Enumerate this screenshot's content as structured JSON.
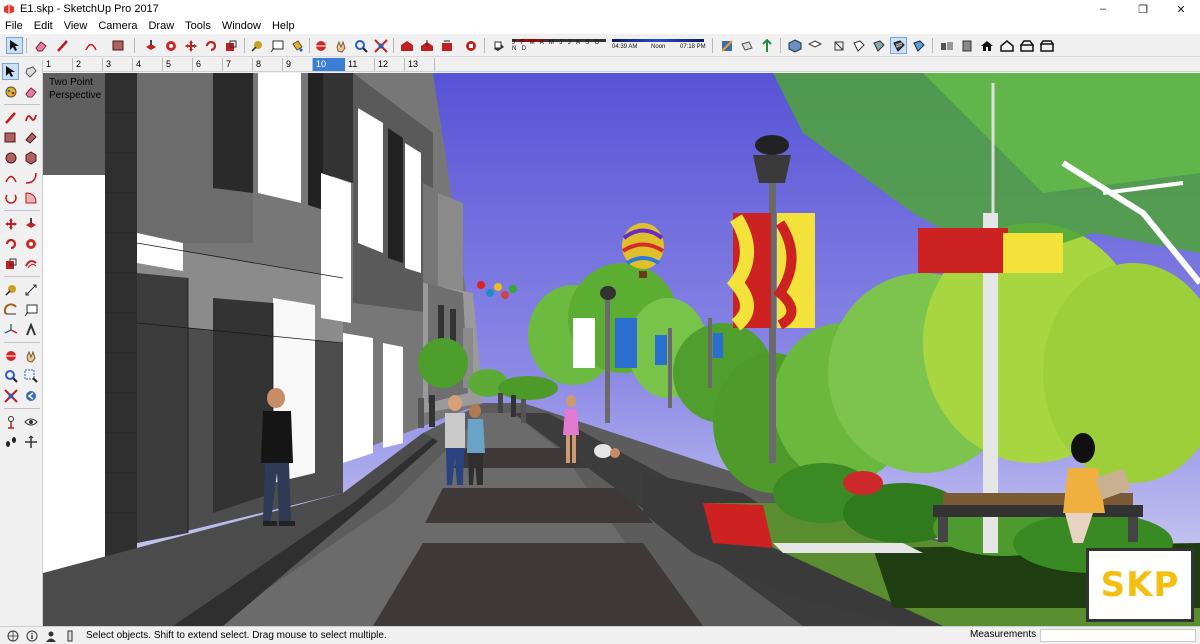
{
  "window": {
    "title": "E1.skp - SketchUp Pro 2017",
    "minimize": "–",
    "maximize": "❐",
    "close": "✕"
  },
  "menu": [
    "File",
    "Edit",
    "View",
    "Camera",
    "Draw",
    "Tools",
    "Window",
    "Help"
  ],
  "shadow_settings": {
    "months": "J F M A M J J A S O N D",
    "time_start": "04:39 AM",
    "time_mid": "Noon",
    "time_end": "07:18 PM"
  },
  "scenes": [
    "1",
    "2",
    "3",
    "4",
    "5",
    "6",
    "7",
    "8",
    "9",
    "10",
    "11",
    "12",
    "13"
  ],
  "active_scene": "10",
  "viewport": {
    "camera_label": "Two Point\nPerspective",
    "watermark": "SKP"
  },
  "status": {
    "message": "Select objects. Shift to extend select. Drag mouse to select multiple.",
    "measurements_label": "Measurements",
    "measurements_value": ""
  },
  "colors": {
    "sky_top": "#5a55d8",
    "sky_bottom": "#d6d6f4",
    "building": "#707070",
    "pavement": "#5c5c5c",
    "tree_green": "#63b53e",
    "accent_selected": "#3b7ed6"
  }
}
